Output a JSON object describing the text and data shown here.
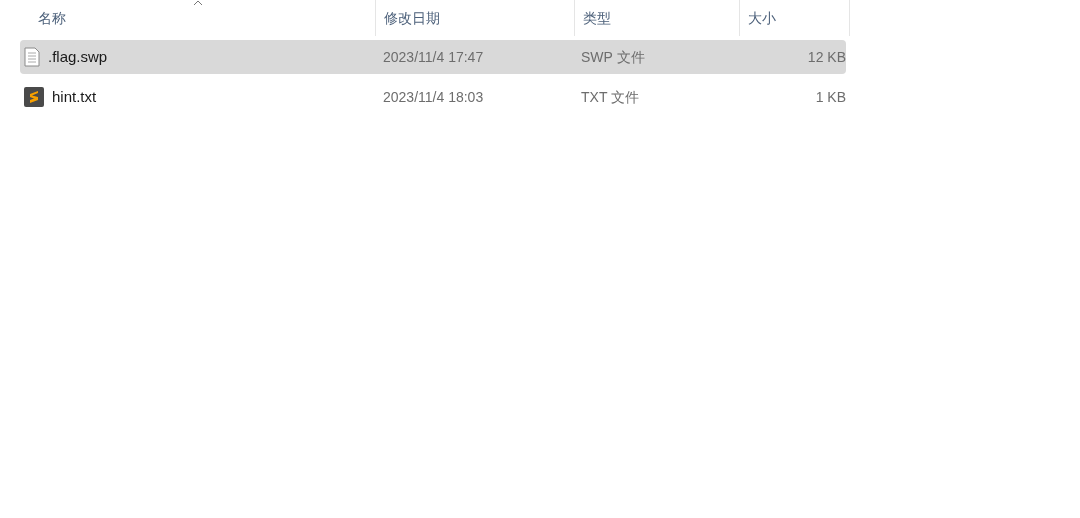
{
  "columns": [
    {
      "label": "名称",
      "sorted": true
    },
    {
      "label": "修改日期",
      "sorted": false
    },
    {
      "label": "类型",
      "sorted": false
    },
    {
      "label": "大小",
      "sorted": false
    }
  ],
  "files": [
    {
      "kind": "document",
      "name": ".flag.swp",
      "modified": "2023/11/4 17:47",
      "type": "SWP 文件",
      "size": "12 KB",
      "selected": true
    },
    {
      "kind": "editor",
      "name": "hint.txt",
      "modified": "2023/11/4 18:03",
      "type": "TXT 文件",
      "size": "1 KB",
      "selected": false
    }
  ]
}
